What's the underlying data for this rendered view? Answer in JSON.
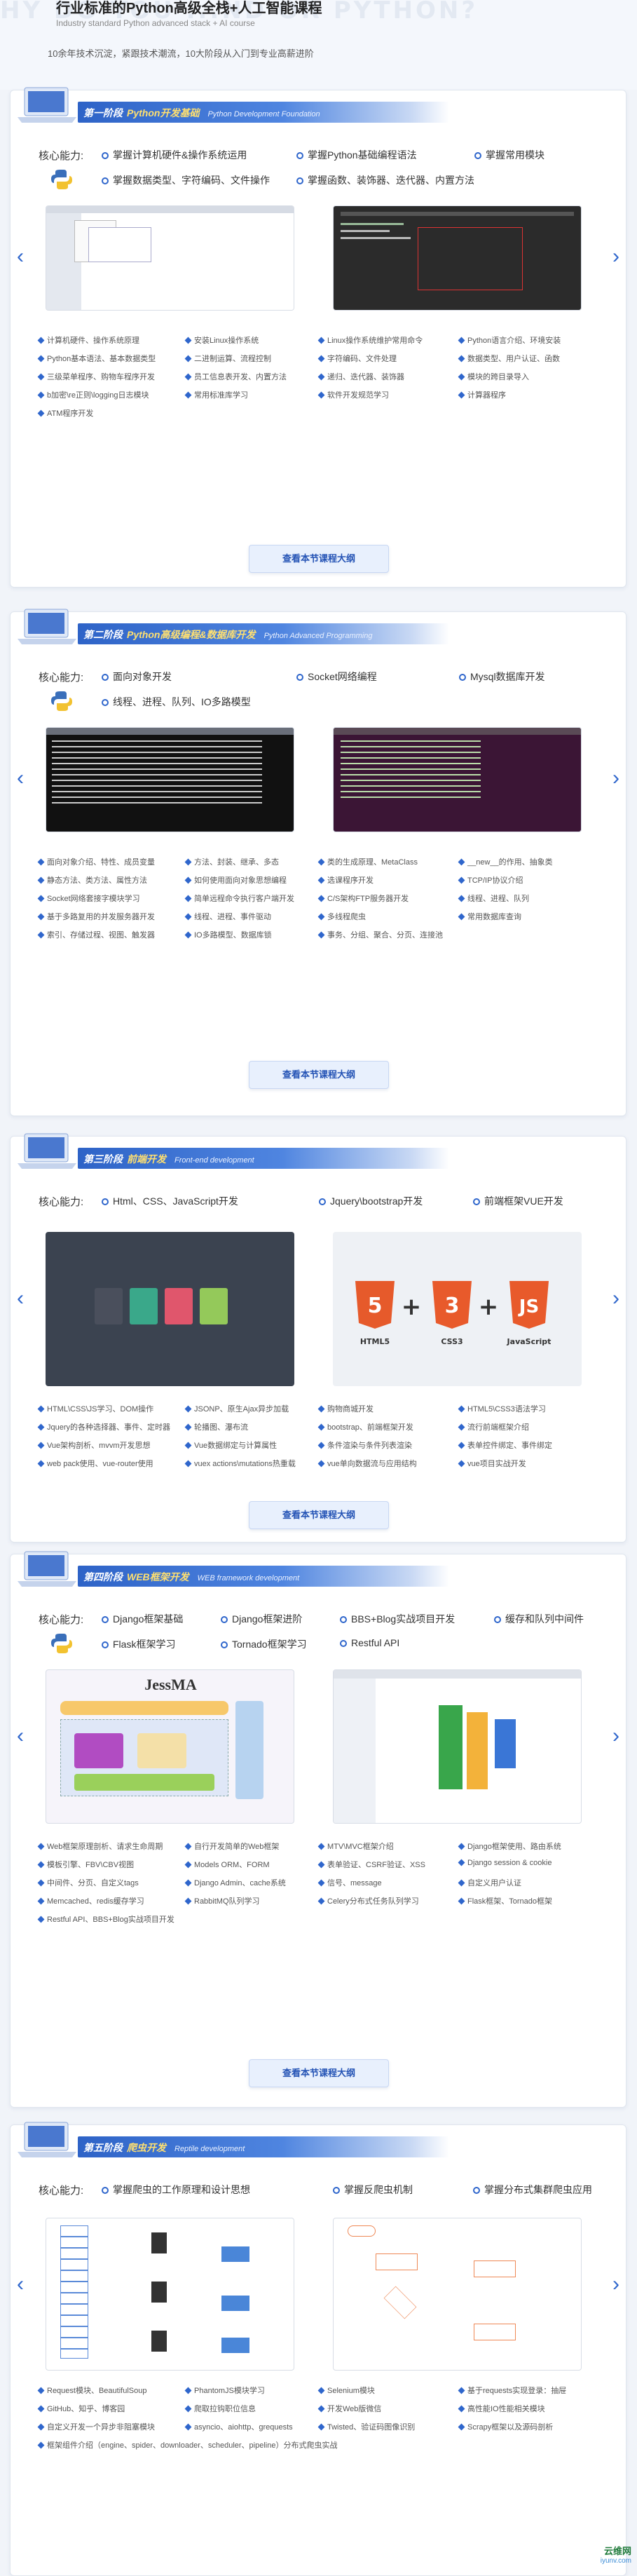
{
  "hero": {
    "watermark": "HY DO YOU ...ND OR PYTHON?",
    "title": "行业标准的Python高级全栈+人工智能课程",
    "subtitle": "Industry standard Python advanced stack + AI course",
    "desc": "10余年技术沉淀，紧跟技术潮流，10大阶段从入门到专业高薪进阶"
  },
  "common": {
    "core_label": "核心能力:",
    "more_label": "查看本节课程大纲"
  },
  "stages": [
    {
      "num": "第一阶段",
      "name": "Python开发基础",
      "en": "Python Development Foundation",
      "core": [
        "掌握计算机硬件&操作系统运用",
        "掌握Python基础编程语法",
        "掌握常用模块",
        "掌握数据类型、字符编码、文件操作",
        "掌握函数、装饰器、迭代器、内置方法"
      ],
      "points": [
        "计算机硬件、操作系统原理",
        "安装Linux操作系统",
        "Linux操作系统维护常用命令",
        "Python语言介绍、环境安装",
        "Python基本语法、基本数据类型",
        "二进制运算、流程控制",
        "字符编码、文件处理",
        "数据类型、用户认证、函数",
        "三级菜单程序、购物车程序开发",
        "员工信息表开发、内置方法",
        "递归、迭代器、装饰器",
        "模块的跨目录导入",
        "b加密\\re正则\\logging日志模块",
        "常用标准库学习",
        "软件开发规范学习",
        "计算器程序",
        "ATM程序开发"
      ]
    },
    {
      "num": "第二阶段",
      "name": "Python高级编程&数据库开发",
      "en": "Python Advanced Programming",
      "core": [
        "面向对象开发",
        "Socket网络编程",
        "Mysql数据库开发",
        "线程、进程、队列、IO多路模型"
      ],
      "points": [
        "面向对象介绍、特性、成员变量",
        "方法、封装、继承、多态",
        "类的生成原理、MetaClass",
        "__new__的作用、抽象类",
        "静态方法、类方法、属性方法",
        "如何使用面向对象思想编程",
        "选课程序开发",
        "TCP/IP协议介绍",
        "Socket网络套接字模块学习",
        "简单远程命令执行客户端开发",
        "C/S架构FTP服务器开发",
        "线程、进程、队列",
        "基于多路复用的并发服务器开发",
        "线程、进程、事件驱动",
        "多线程爬虫",
        "常用数据库查询",
        "索引、存储过程、视图、触发器",
        "IO多路模型、数据库锁",
        "事务、分组、聚合、分页、连接池"
      ]
    },
    {
      "num": "第三阶段",
      "name": "前端开发",
      "en": "Front-end development",
      "core": [
        "Html、CSS、JavaScript开发",
        "Jquery\\bootstrap开发",
        "前端框架VUE开发"
      ],
      "points": [
        "HTML\\CSS\\JS学习、DOM操作",
        "JSONP、原生Ajax异步加载",
        "购物商城开发",
        "HTML5\\CSS3语法学习",
        "Jquery的各种选择器、事件、定时器",
        "轮播图、瀑布流",
        "bootstrap、前端框架开发",
        "流行前端框架介绍",
        "Vue架构剖析、mvvm开发思想",
        "Vue数据绑定与计算属性",
        "条件渲染与条件列表渲染",
        "表单控件绑定、事件绑定",
        "web pack使用、vue-router使用",
        "vuex actions\\mutations热重载",
        "vue单向数据流与应用结构",
        "vue项目实战开发"
      ]
    },
    {
      "num": "第四阶段",
      "name": "WEB框架开发",
      "en": "WEB framework development",
      "core": [
        "Django框架基础",
        "Django框架进阶",
        "BBS+Blog实战项目开发",
        "缓存和队列中间件",
        "Flask框架学习",
        "Tornado框架学习",
        "Restful API"
      ],
      "shot_title": "JessMA",
      "points": [
        "Web框架原理剖析、请求生命周期",
        "自行开发简单的Web框架",
        "MTV\\MVC框架介绍",
        "Django框架使用、路由系统",
        "模板引擎、FBV\\CBV视图",
        "Models ORM、FORM",
        "表单验证、CSRF验证、XSS",
        "Django session & cookie",
        "中间件、分页、自定义tags",
        "Django Admin、cache系统",
        "信号、message",
        "自定义用户认证",
        "Memcached、redis缓存学习",
        "RabbitMQ队列学习",
        "Celery分布式任务队列学习",
        "Flask框架、Tornado框架",
        "Restful API、BBS+Blog实战项目开发"
      ]
    },
    {
      "num": "第五阶段",
      "name": "爬虫开发",
      "en": "Reptile development",
      "core": [
        "掌握爬虫的工作原理和设计思想",
        "掌握反爬虫机制",
        "掌握分布式集群爬虫应用"
      ],
      "points": [
        "Request模块、BeautifulSoup",
        "PhantomJS模块学习",
        "Selenium模块",
        "基于requests实现登录：抽屉",
        "GitHub、知乎、博客园",
        "爬取拉钩职位信息",
        "开发Web版微信",
        "高性能IO性能相关模块",
        "自定义开发一个异步非阻塞模块",
        "asyncio、aiohttp、grequests",
        "Twisted、验证码图像识别",
        "Scrapy框架以及源码剖析",
        "框架组件介绍（engine、spider、downloader、scheduler、pipeline）分布式爬虫实战"
      ]
    }
  ],
  "badge": {
    "top": "云维网",
    "bottom": "iyunv.com"
  },
  "colors": {
    "accent": "#2f66cc",
    "banner": "#2e63c7"
  }
}
